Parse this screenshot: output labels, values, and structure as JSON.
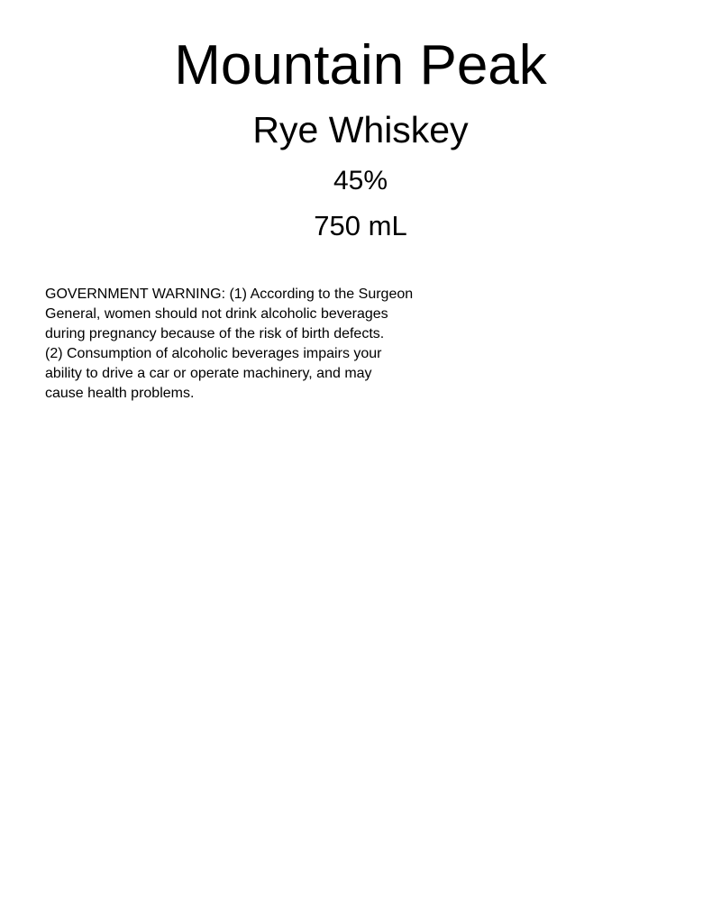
{
  "label": {
    "brand_name": "Mountain Peak",
    "product_type": "Rye Whiskey",
    "alcohol_content": "45%",
    "net_contents": "750 mL",
    "government_warning": {
      "lines": [
        "GOVERNMENT WARNING: (1) According to the Surgeon",
        "General, women should not drink alcoholic beverages",
        "during pregnancy because of the risk of birth defects.",
        "(2) Consumption of alcoholic beverages impairs your",
        "ability to drive a car or operate machinery, and may",
        "cause health problems."
      ]
    }
  }
}
